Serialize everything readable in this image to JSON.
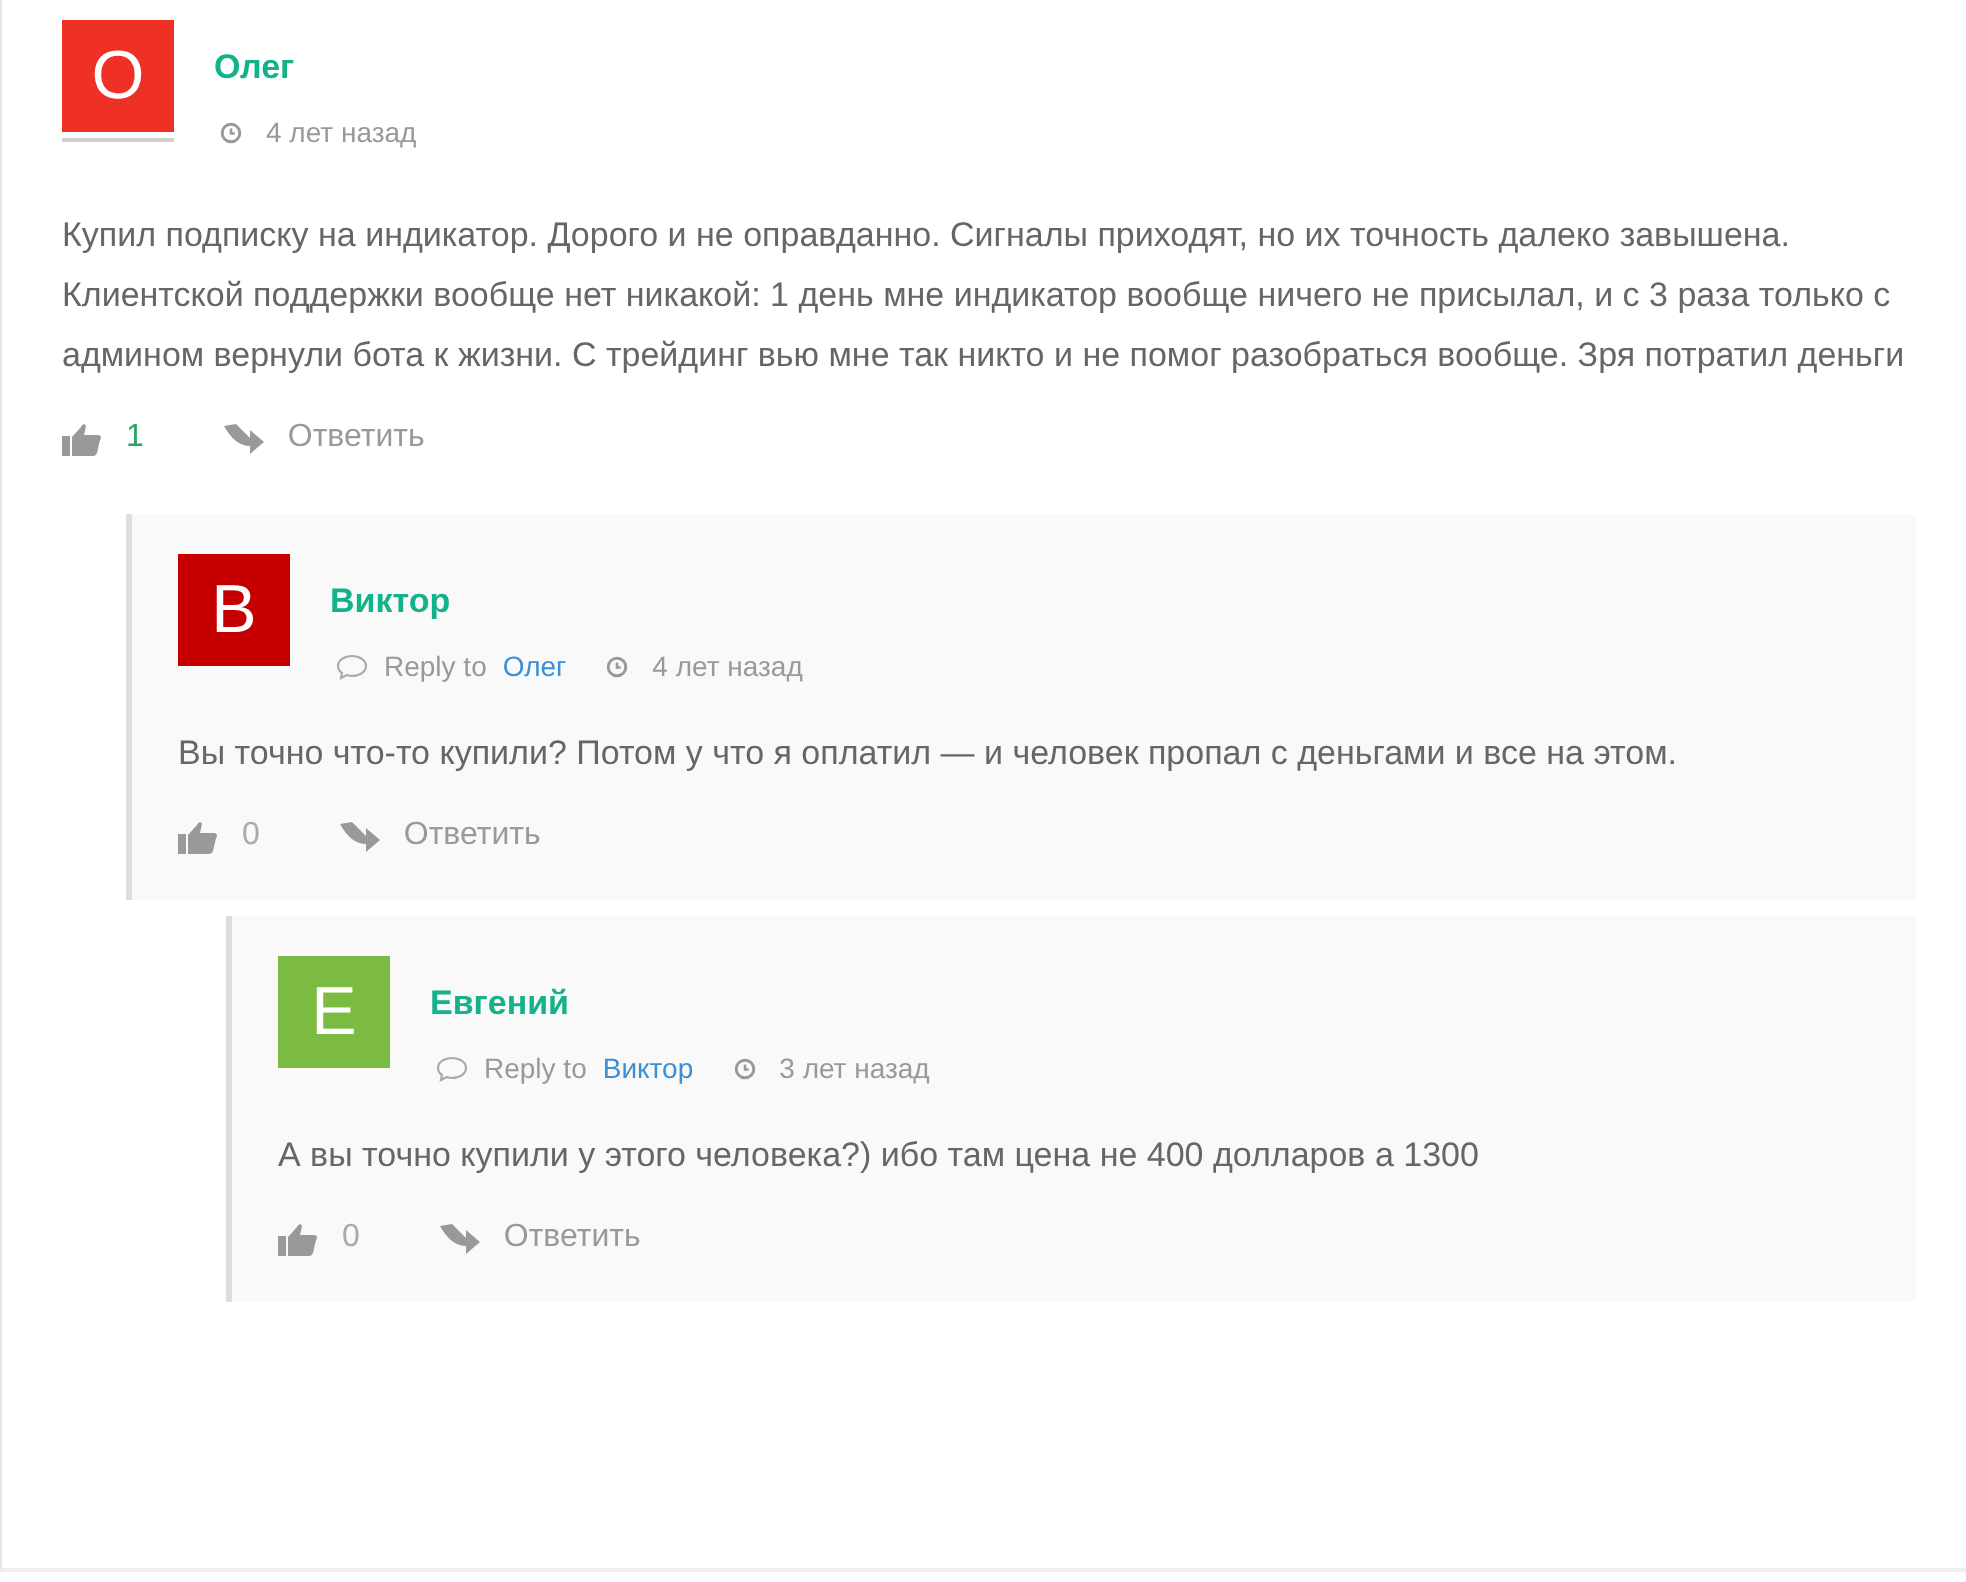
{
  "comments": [
    {
      "author": "Олег",
      "initial": "О",
      "color": "#ee3124",
      "time": "4 лет назад",
      "text": "Купил подписку на индикатор. Дорого и не оправданно. Сигналы приходят, но их точность далеко завышена. Клиентской поддержки вообще нет никакой: 1 день мне индикатор вообще ничего не присылал, и с 3 раза только с админом вернули бота к жизни. С трейдинг вью мне так никто и не помог разобраться вообще. Зря потратил деньги",
      "likes": "1",
      "voted": true,
      "reply_label": "Ответить",
      "children": [
        {
          "author": "Виктор",
          "initial": "В",
          "color": "#c60000",
          "reply_prefix": "Reply to",
          "reply_to": "Олег",
          "time": "4 лет назад",
          "text": "Вы точно что-то купили? Потом у что я оплатил — и человек пропал с деньгами и все на этом.",
          "likes": "0",
          "voted": false,
          "reply_label": "Ответить",
          "children": [
            {
              "author": "Евгений",
              "initial": "Е",
              "color": "#7cbb42",
              "reply_prefix": "Reply to",
              "reply_to": "Виктор",
              "time": "3 лет назад",
              "text": "А вы точно купили у этого человека?) ибо там цена не 400 долларов а 1300",
              "likes": "0",
              "voted": false,
              "reply_label": "Ответить"
            }
          ]
        }
      ]
    }
  ]
}
